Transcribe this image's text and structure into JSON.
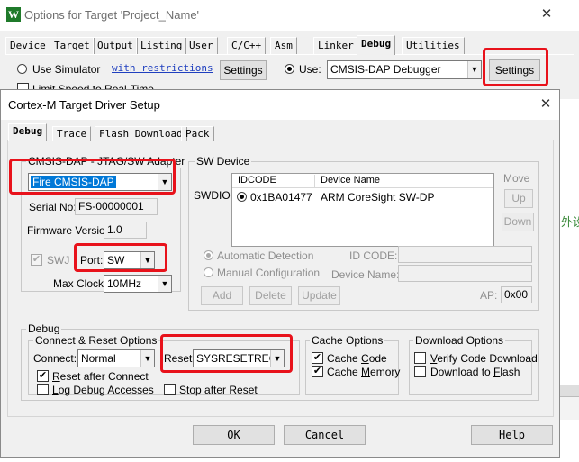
{
  "back_window": {
    "title": "Options for Target 'Project_Name'",
    "app_icon_glyph": "W",
    "close_glyph": "✕",
    "tabs": [
      "Device",
      "Target",
      "Output",
      "Listing",
      "User",
      "C/C++",
      "Asm",
      "Linker",
      "Debug",
      "Utilities"
    ],
    "active_tab": "Debug",
    "use_simulator_label": "Use Simulator",
    "use_simulator_checked": false,
    "with_restrictions_link": "with restrictions",
    "settings_left_label": "Settings",
    "limit_speed_label": "Limit Speed to Real-Time",
    "use_label": "Use:",
    "use_checked": true,
    "debugger_value": "CMSIS-DAP Debugger",
    "settings_right_label": "Settings"
  },
  "dialog": {
    "title": "Cortex-M Target Driver Setup",
    "close_glyph": "✕",
    "tabs": [
      "Debug",
      "Trace",
      "Flash Download",
      "Pack"
    ],
    "active_tab": "Debug",
    "adapter": {
      "group_title": "CMSIS-DAP - JTAG/SW Adapter",
      "selected": "Fire CMSIS-DAP",
      "serial_label": "Serial No:",
      "serial_value": "FS-00000001",
      "firmware_label": "Firmware Version:",
      "firmware_value": "1.0",
      "swj_label": "SWJ",
      "swj_checked": true,
      "port_label": "Port:",
      "port_value": "SW",
      "max_clock_label": "Max Clock:",
      "max_clock_value": "10MHz"
    },
    "sw_device": {
      "group_title": "SW Device",
      "swdio_label": "SWDIO",
      "columns": [
        "IDCODE",
        "Device Name"
      ],
      "rows": [
        {
          "idcode": "0x1BA01477",
          "device_name": "ARM CoreSight SW-DP"
        }
      ],
      "move_label": "Move",
      "up_label": "Up",
      "down_label": "Down",
      "auto_detect_label": "Automatic Detection",
      "manual_config_label": "Manual Configuration",
      "id_code_label": "ID CODE:",
      "device_name_label": "Device Name:",
      "add_label": "Add",
      "delete_label": "Delete",
      "update_label": "Update",
      "ap_label": "AP:",
      "ap_value": "0x00"
    },
    "debug": {
      "group_title": "Debug",
      "connect_reset": {
        "group_title": "Connect & Reset Options",
        "connect_label": "Connect:",
        "connect_value": "Normal",
        "reset_label": "Reset:",
        "reset_value": "SYSRESETREQ",
        "reset_after_connect_label": "Reset after Connect",
        "reset_after_connect_checked": true,
        "log_debug_label": "Log Debug Accesses",
        "log_debug_checked": false,
        "stop_after_reset_label": "Stop after Reset",
        "stop_after_reset_checked": false
      },
      "cache": {
        "group_title": "Cache Options",
        "cache_code_label": "Cache Code",
        "cache_code_checked": true,
        "cache_memory_label": "Cache Memory",
        "cache_memory_checked": true
      },
      "download": {
        "group_title": "Download Options",
        "verify_label": "Verify Code Download",
        "verify_checked": false,
        "download_flash_label": "Download to Flash",
        "download_flash_checked": false
      }
    },
    "buttons": {
      "ok": "OK",
      "cancel": "Cancel",
      "help": "Help"
    }
  },
  "background_edge_text": "外设",
  "check_glyph": "✔",
  "colors": {
    "highlight_red": "#e8121b",
    "selection_blue": "#0078d7",
    "dialog_bg": "#f0f0f0"
  }
}
